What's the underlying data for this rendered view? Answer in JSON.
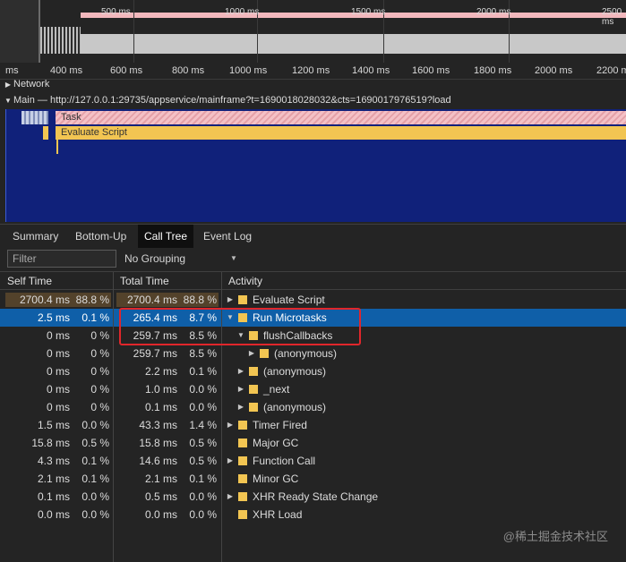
{
  "overview": {
    "ticks": [
      "500 ms",
      "1000 ms",
      "1500 ms",
      "2000 ms",
      "2500 ms"
    ]
  },
  "ruler": {
    "ticks": [
      "ms",
      "400 ms",
      "600 ms",
      "800 ms",
      "1000 ms",
      "1200 ms",
      "1400 ms",
      "1600 ms",
      "1800 ms",
      "2000 ms",
      "2200 ms"
    ]
  },
  "tracks": {
    "network": "Network",
    "main": "Main — http://127.0.0.1:29735/appservice/mainframe?t=1690018028032&cts=1690017976519?load",
    "task_label": "Task",
    "eval_label": "Evaluate Script"
  },
  "tabs": [
    "Summary",
    "Bottom-Up",
    "Call Tree",
    "Event Log"
  ],
  "active_tab": "Call Tree",
  "filter": {
    "placeholder": "Filter",
    "grouping": "No Grouping"
  },
  "columns": {
    "self": "Self Time",
    "total": "Total Time",
    "activity": "Activity"
  },
  "rows": [
    {
      "self_ms": "2700.4 ms",
      "self_pct": "88.8 %",
      "total_ms": "2700.4 ms",
      "total_pct": "88.8 %",
      "activity": "Evaluate Script",
      "depth": 0,
      "arrow": "right"
    },
    {
      "self_ms": "2.5 ms",
      "self_pct": "0.1 %",
      "total_ms": "265.4 ms",
      "total_pct": "8.7 %",
      "activity": "Run Microtasks",
      "depth": 0,
      "arrow": "down",
      "selected": true
    },
    {
      "self_ms": "0 ms",
      "self_pct": "0 %",
      "total_ms": "259.7 ms",
      "total_pct": "8.5 %",
      "activity": "flushCallbacks",
      "depth": 1,
      "arrow": "down"
    },
    {
      "self_ms": "0 ms",
      "self_pct": "0 %",
      "total_ms": "259.7 ms",
      "total_pct": "8.5 %",
      "activity": "(anonymous)",
      "depth": 2,
      "arrow": "right"
    },
    {
      "self_ms": "0 ms",
      "self_pct": "0 %",
      "total_ms": "2.2 ms",
      "total_pct": "0.1 %",
      "activity": "(anonymous)",
      "depth": 1,
      "arrow": "right"
    },
    {
      "self_ms": "0 ms",
      "self_pct": "0 %",
      "total_ms": "1.0 ms",
      "total_pct": "0.0 %",
      "activity": "_next",
      "depth": 1,
      "arrow": "right"
    },
    {
      "self_ms": "0 ms",
      "self_pct": "0 %",
      "total_ms": "0.1 ms",
      "total_pct": "0.0 %",
      "activity": "(anonymous)",
      "depth": 1,
      "arrow": "right"
    },
    {
      "self_ms": "1.5 ms",
      "self_pct": "0.0 %",
      "total_ms": "43.3 ms",
      "total_pct": "1.4 %",
      "activity": "Timer Fired",
      "depth": 0,
      "arrow": "right"
    },
    {
      "self_ms": "15.8 ms",
      "self_pct": "0.5 %",
      "total_ms": "15.8 ms",
      "total_pct": "0.5 %",
      "activity": "Major GC",
      "depth": 0,
      "arrow": "none"
    },
    {
      "self_ms": "4.3 ms",
      "self_pct": "0.1 %",
      "total_ms": "14.6 ms",
      "total_pct": "0.5 %",
      "activity": "Function Call",
      "depth": 0,
      "arrow": "right"
    },
    {
      "self_ms": "2.1 ms",
      "self_pct": "0.1 %",
      "total_ms": "2.1 ms",
      "total_pct": "0.1 %",
      "activity": "Minor GC",
      "depth": 0,
      "arrow": "none"
    },
    {
      "self_ms": "0.1 ms",
      "self_pct": "0.0 %",
      "total_ms": "0.5 ms",
      "total_pct": "0.0 %",
      "activity": "XHR Ready State Change",
      "depth": 0,
      "arrow": "right"
    },
    {
      "self_ms": "0.0 ms",
      "self_pct": "0.0 %",
      "total_ms": "0.0 ms",
      "total_pct": "0.0 %",
      "activity": "XHR Load",
      "depth": 0,
      "arrow": "none"
    }
  ],
  "watermark": "@稀土掘金技术社区",
  "colors": {
    "accent_selected": "#0f5fa8",
    "script_yellow": "#f2c552",
    "highlight_box": "#e0262b"
  }
}
